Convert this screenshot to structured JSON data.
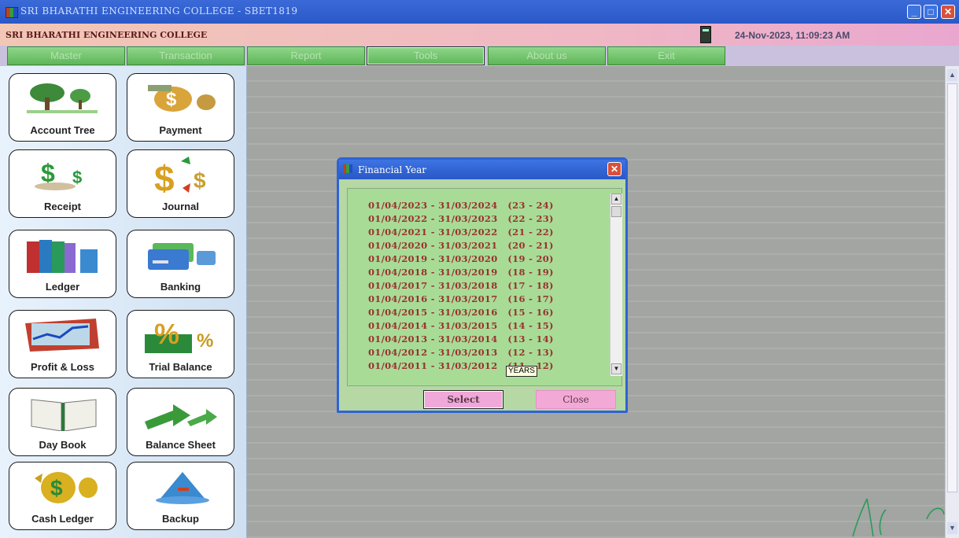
{
  "window": {
    "title": "SRI BHARATHI ENGINEERING COLLEGE - SBET1819"
  },
  "header": {
    "college": "SRI BHARATHI ENGINEERING COLLEGE",
    "datetime": "24-Nov-2023, 11:09:23 AM"
  },
  "menu": [
    "Master",
    "Transaction",
    "Report",
    "Tools",
    "About us",
    "Exit"
  ],
  "tiles": {
    "account_tree": "Account Tree",
    "payment": "Payment",
    "receipt": "Receipt",
    "journal": "Journal",
    "ledger": "Ledger",
    "banking": "Banking",
    "profit_loss": "Profit & Loss",
    "trial_balance": "Trial Balance",
    "day_book": "Day Book",
    "balance_sheet": "Balance Sheet",
    "cash_ledger": "Cash Ledger",
    "backup": "Backup"
  },
  "dialog": {
    "title": "Financial Year",
    "years": [
      "01/04/2023 - 31/03/2024   (23 - 24)",
      "01/04/2022 - 31/03/2023   (22 - 23)",
      "01/04/2021 - 31/03/2022   (21 - 22)",
      "01/04/2020 - 31/03/2021   (20 - 21)",
      "01/04/2019 - 31/03/2020   (19 - 20)",
      "01/04/2018 - 31/03/2019   (18 - 19)",
      "01/04/2017 - 31/03/2018   (17 - 18)",
      "01/04/2016 - 31/03/2017   (16 - 17)",
      "01/04/2015 - 31/03/2016   (15 - 16)",
      "01/04/2014 - 31/03/2015   (14 - 15)",
      "01/04/2013 - 31/03/2014   (13 - 14)",
      "01/04/2012 - 31/03/2013   (12 - 13)",
      "01/04/2011 - 31/03/2012   (11 - 12)"
    ],
    "tooltip": "YEARS",
    "select_label": "Select",
    "close_label": "Close"
  }
}
